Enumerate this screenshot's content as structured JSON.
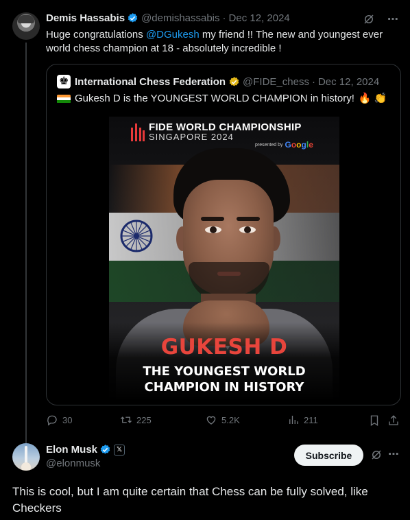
{
  "tweet1": {
    "author": "Demis Hassabis",
    "handle": "@demishassabis",
    "sep": "·",
    "date": "Dec 12, 2024",
    "text_before": "Huge congratulations ",
    "mention": "@DGukesh",
    "text_after": " my friend !! The new and youngest ever world chess champion at 18 - absolutely incredible !"
  },
  "quote": {
    "author": "International Chess Federation",
    "handle": "@FIDE_chess",
    "sep": "·",
    "date": "Dec 12, 2024",
    "text": "Gukesh D is the YOUNGEST WORLD CHAMPION in history!",
    "poster": {
      "title": "FIDE WORLD CHAMPIONSHIP",
      "subtitle": "SINGAPORE 2024",
      "presented_by": "presented by",
      "sponsor": "Google",
      "name": "GUKESH D",
      "tagline_line1": "THE YOUNGEST WORLD",
      "tagline_line2": "CHAMPION IN HISTORY"
    }
  },
  "actions": {
    "replies": "30",
    "retweets": "225",
    "likes": "5.2K",
    "views": "211"
  },
  "tweet2": {
    "author": "Elon Musk",
    "handle": "@elonmusk",
    "subscribe_label": "Subscribe",
    "text": "This is cool, but I am quite certain that Chess can be fully solved, like Checkers"
  },
  "colors": {
    "background": "#000000",
    "link": "#1d9bf0",
    "muted": "#71767b",
    "verified_blue": "#1d9bf0",
    "verified_gold": "#e2b719",
    "poster_name_red": "#e8453c"
  },
  "icons": {
    "more": "⋯",
    "x_badge": "𝕏"
  }
}
